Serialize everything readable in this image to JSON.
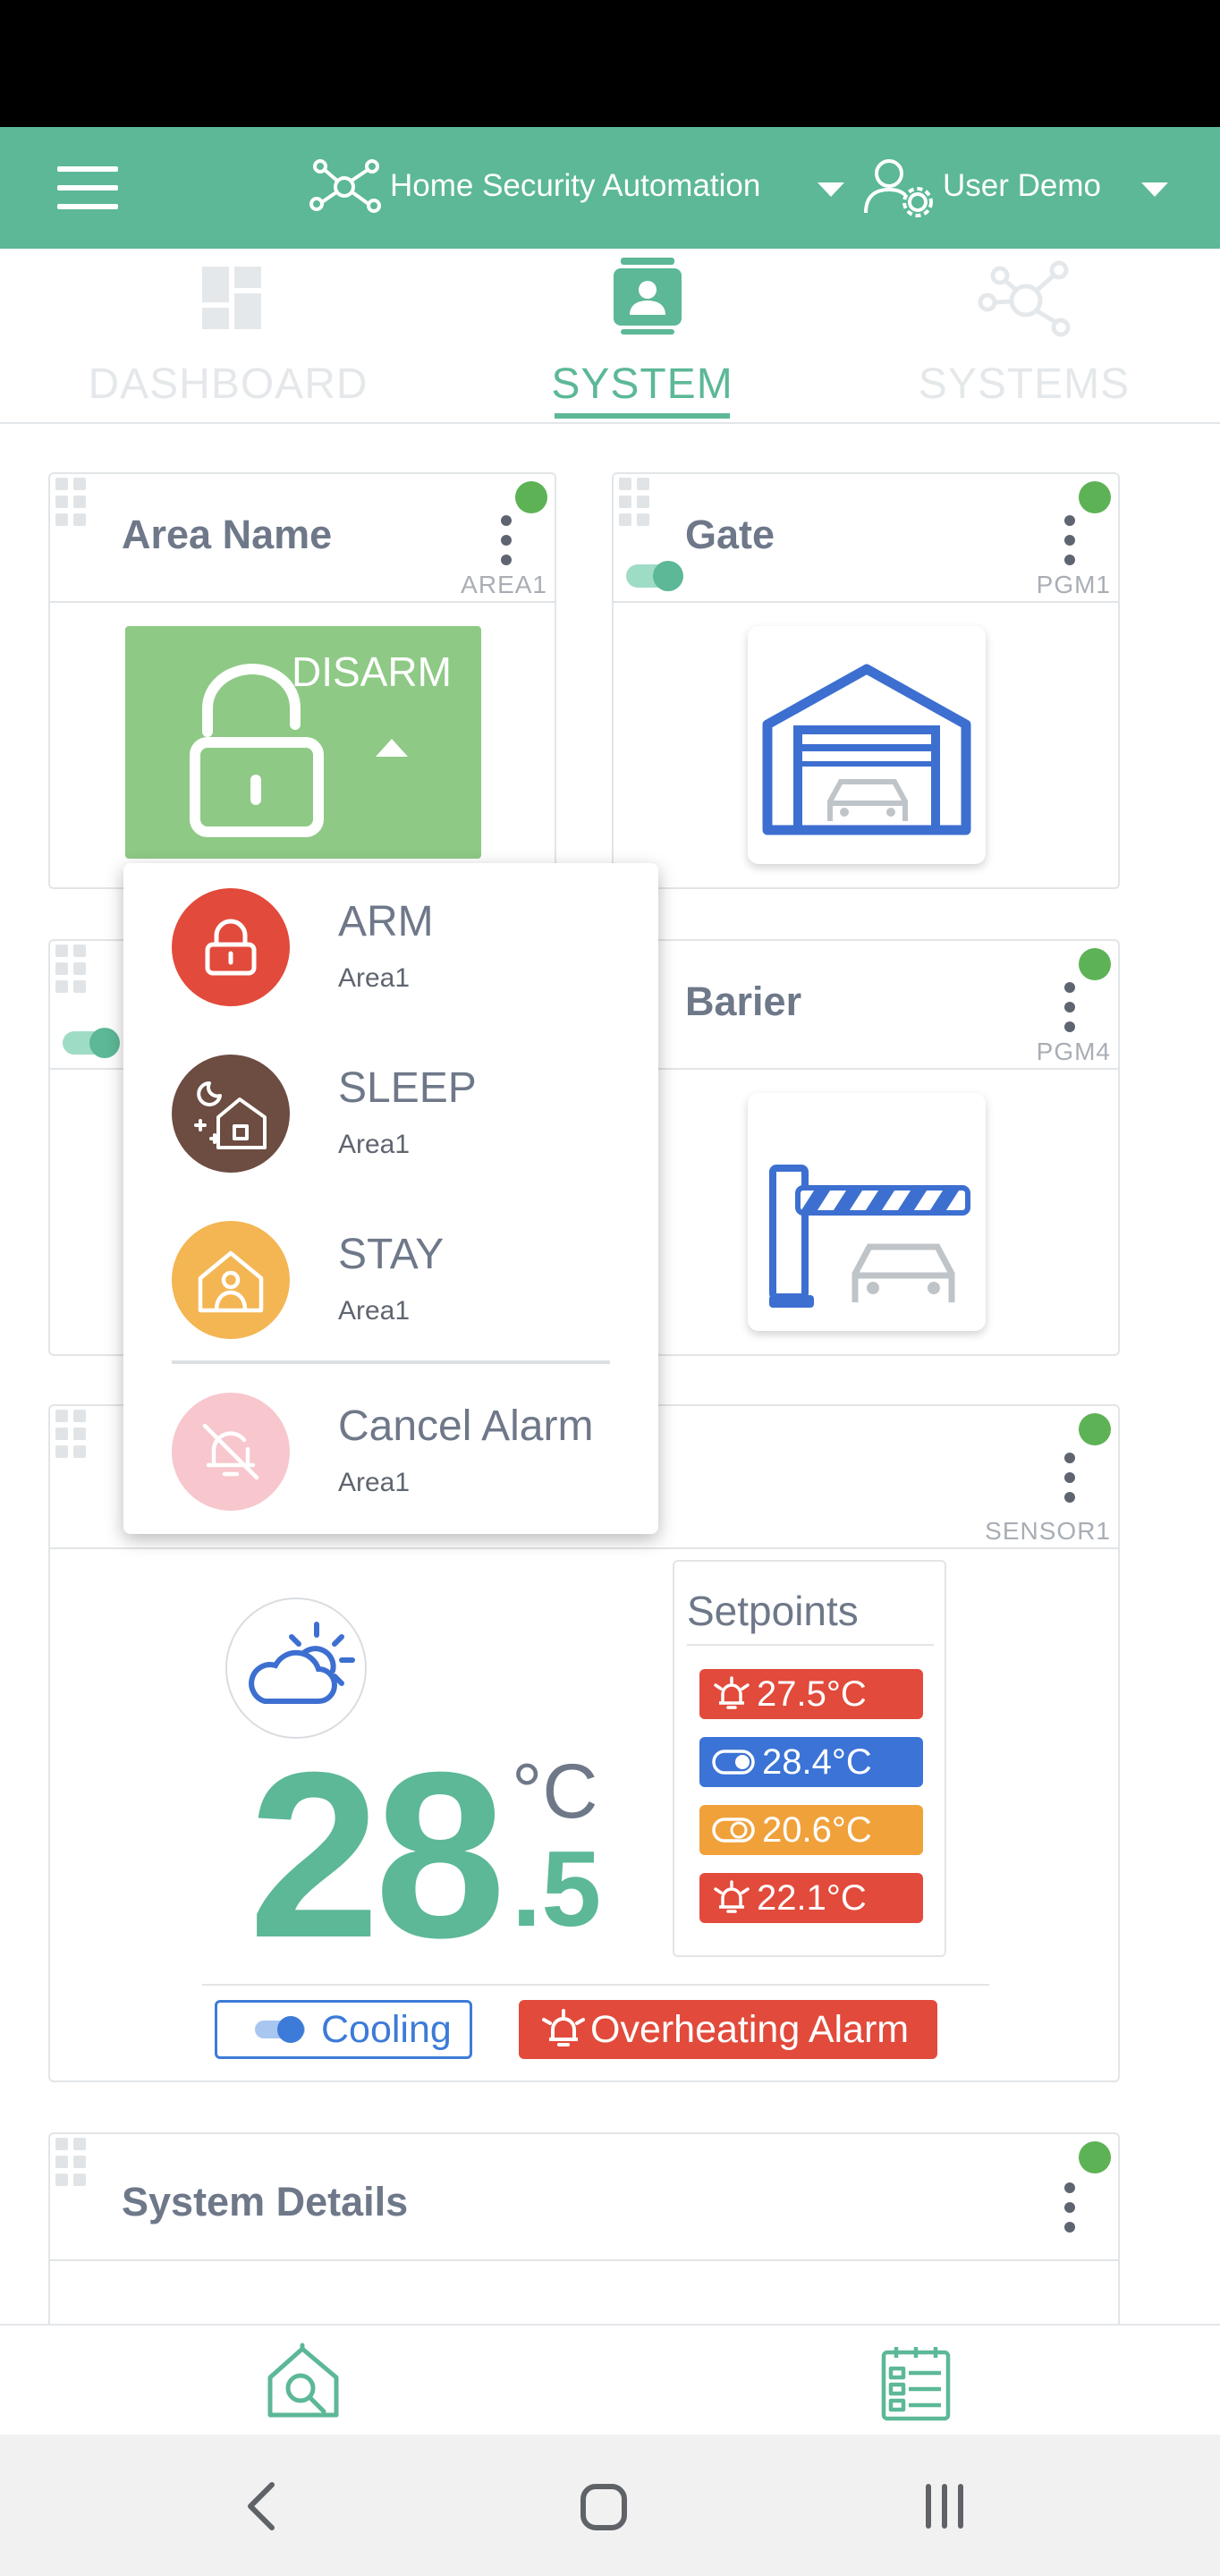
{
  "header": {
    "system_name": "Home Security Automation",
    "user_name": "User Demo",
    "accent": "#5cb896"
  },
  "tabs": [
    {
      "label": "DASHBOARD",
      "active": false
    },
    {
      "label": "SYSTEM",
      "active": true
    },
    {
      "label": "SYSTEMS",
      "active": false
    }
  ],
  "cards": {
    "area": {
      "title": "Area Name",
      "id": "AREA1",
      "button_label": "DISARM",
      "button_color": "#8ec985"
    },
    "gate": {
      "title": "Gate",
      "id": "PGM1",
      "icon": "garage-icon"
    },
    "barier": {
      "title": "Barier",
      "id": "PGM4",
      "icon": "barrier-gate-icon"
    },
    "sensor": {
      "id": "SENSOR1",
      "temp_whole": "28",
      "temp_decimal": ".5",
      "unit": "°C",
      "setpoints_title": "Setpoints",
      "setpoints": [
        {
          "value": "27.5°C",
          "color": "#e24a3b",
          "icon": "alarm-bell-icon"
        },
        {
          "value": "28.4°C",
          "color": "#3b73d6",
          "icon": "toggle-icon"
        },
        {
          "value": "20.6°C",
          "color": "#f0a13a",
          "icon": "toggle-icon"
        },
        {
          "value": "22.1°C",
          "color": "#e24a3b",
          "icon": "alarm-bell-icon"
        }
      ],
      "mode_label": "Cooling",
      "alarm_label": "Overheating Alarm"
    },
    "details": {
      "title": "System Details"
    }
  },
  "menu": {
    "items": [
      {
        "label": "ARM",
        "sub": "Area1",
        "color": "#e24a3b",
        "icon": "lock-icon"
      },
      {
        "label": "SLEEP",
        "sub": "Area1",
        "color": "#6d4c41",
        "icon": "sleep-house-icon"
      },
      {
        "label": "STAY",
        "sub": "Area1",
        "color": "#f4b553",
        "icon": "stay-house-icon"
      },
      {
        "label": "Cancel Alarm",
        "sub": "Area1",
        "color": "#f7c7cd",
        "icon": "bell-off-icon"
      }
    ]
  }
}
